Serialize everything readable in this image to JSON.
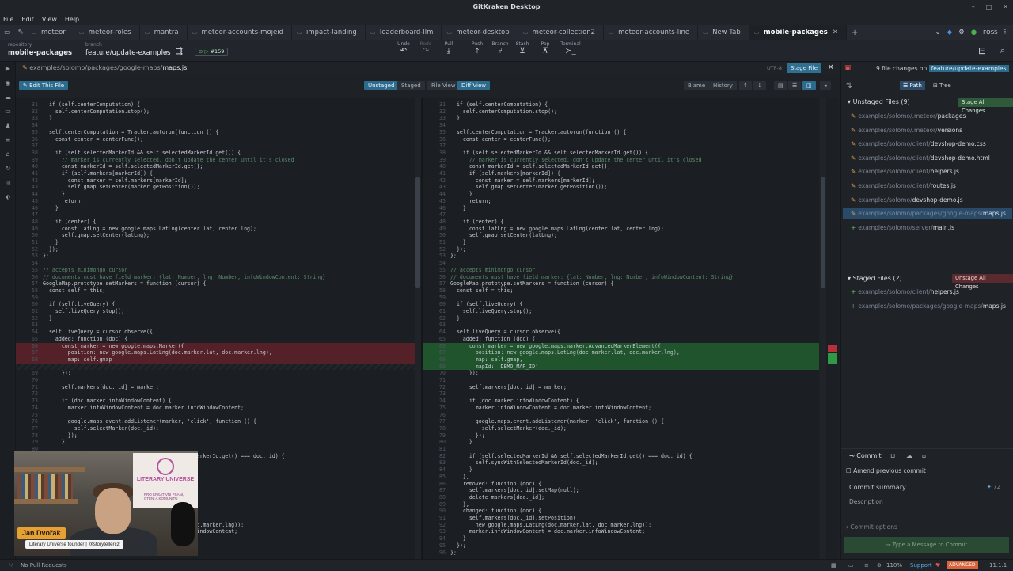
{
  "window": {
    "title": "GitKraken Desktop",
    "min": "–",
    "max": "□",
    "close": "✕"
  },
  "menu": [
    "File",
    "Edit",
    "View",
    "Help"
  ],
  "tabs": [
    {
      "label": "meteor",
      "active": false
    },
    {
      "label": "meteor-roles",
      "active": false
    },
    {
      "label": "mantra",
      "active": false
    },
    {
      "label": "meteor-accounts-mojeid",
      "active": false
    },
    {
      "label": "impact-landing",
      "active": false
    },
    {
      "label": "leaderboard-llm",
      "active": false
    },
    {
      "label": "meteor-desktop",
      "active": false
    },
    {
      "label": "meteor-collection2",
      "active": false
    },
    {
      "label": "meteor-accounts-line",
      "active": false
    },
    {
      "label": "New Tab",
      "active": false
    },
    {
      "label": "mobile-packages",
      "active": true
    }
  ],
  "toolbar": {
    "repo_label": "repository",
    "repo": "mobile-packages",
    "branch_label": "branch",
    "branch": "feature/update-examples",
    "pr_badge": "#159",
    "actions": [
      "Undo",
      "Redo",
      "Pull",
      "Push",
      "Branch",
      "Stash",
      "Pop",
      "Terminal"
    ],
    "org": "FOSS"
  },
  "file": {
    "dir": "examples/solomo/packages/google-maps/",
    "name": "maps.js",
    "encoding": "UTF-8",
    "stage_label": "Stage File"
  },
  "views": {
    "edit": "Edit This File",
    "unstaged": "Unstaged",
    "staged": "Staged",
    "file_view": "File View",
    "diff_view": "Diff View",
    "blame": "Blame",
    "history": "History"
  },
  "left_code": [
    [
      31,
      "  if (self.centerComputation) {",
      ""
    ],
    [
      32,
      "    self.centerComputation.stop();",
      ""
    ],
    [
      33,
      "  }",
      ""
    ],
    [
      34,
      "",
      ""
    ],
    [
      35,
      "  self.centerComputation = Tracker.autorun(function () {",
      ""
    ],
    [
      36,
      "    const center = centerFunc();",
      ""
    ],
    [
      37,
      "",
      ""
    ],
    [
      38,
      "    if (self.selectedMarkerId && self.selectedMarkerId.get()) {",
      ""
    ],
    [
      39,
      "      // marker is currently selected, don't update the center until it's closed",
      "cm"
    ],
    [
      40,
      "      const markerId = self.selectedMarkerId.get();",
      ""
    ],
    [
      41,
      "      if (self.markers[markerId]) {",
      ""
    ],
    [
      42,
      "        const marker = self.markers[markerId];",
      ""
    ],
    [
      43,
      "        self.gmap.setCenter(marker.getPosition());",
      ""
    ],
    [
      44,
      "      }",
      ""
    ],
    [
      45,
      "      return;",
      ""
    ],
    [
      46,
      "    }",
      ""
    ],
    [
      47,
      "",
      ""
    ],
    [
      48,
      "    if (center) {",
      ""
    ],
    [
      49,
      "      const latLng = new google.maps.LatLng(center.lat, center.lng);",
      ""
    ],
    [
      50,
      "      self.gmap.setCenter(latLng);",
      ""
    ],
    [
      51,
      "    }",
      ""
    ],
    [
      52,
      "  });",
      ""
    ],
    [
      53,
      "};",
      ""
    ],
    [
      54,
      "",
      ""
    ],
    [
      55,
      "// accepts minimongo cursor",
      "cm"
    ],
    [
      56,
      "// documents must have field marker: {lat: Number, lng: Number, infoWindowContent: String}",
      "cm"
    ],
    [
      57,
      "GoogleMap.prototype.setMarkers = function (cursor) {",
      ""
    ],
    [
      58,
      "  const self = this;",
      ""
    ],
    [
      59,
      "",
      ""
    ],
    [
      60,
      "  if (self.liveQuery) {",
      ""
    ],
    [
      61,
      "    self.liveQuery.stop();",
      ""
    ],
    [
      62,
      "  }",
      ""
    ],
    [
      63,
      "",
      ""
    ],
    [
      64,
      "  self.liveQuery = cursor.observe({",
      ""
    ],
    [
      65,
      "    added: function (doc) {",
      ""
    ],
    [
      66,
      "      const marker = new google.maps.Marker({",
      "del"
    ],
    [
      67,
      "        position: new google.maps.LatLng(doc.marker.lat, doc.marker.lng),",
      "del"
    ],
    [
      68,
      "        map: self.gmap",
      "del"
    ],
    [
      "",
      "",
      "hatch"
    ],
    [
      69,
      "      });",
      ""
    ],
    [
      70,
      "",
      ""
    ],
    [
      71,
      "      self.markers[doc._id] = marker;",
      ""
    ],
    [
      72,
      "",
      ""
    ],
    [
      73,
      "      if (doc.marker.infoWindowContent) {",
      ""
    ],
    [
      74,
      "        marker.infoWindowContent = doc.marker.infoWindowContent;",
      ""
    ],
    [
      75,
      "",
      ""
    ],
    [
      76,
      "        google.maps.event.addListener(marker, 'click', function () {",
      ""
    ],
    [
      77,
      "          self.selectMarker(doc._id);",
      ""
    ],
    [
      78,
      "        });",
      ""
    ],
    [
      79,
      "      }",
      ""
    ],
    [
      80,
      "",
      ""
    ],
    [
      81,
      "      if (self.selectedMarkerId && self.selectedMarkerId.get() === doc._id) {",
      ""
    ],
    [
      82,
      "        self.syncWithSelectedMarkerId(doc._id);",
      ""
    ],
    [
      83,
      "      }",
      ""
    ],
    [
      84,
      "    },",
      ""
    ],
    [
      85,
      "    removed: function (doc) {",
      ""
    ],
    [
      86,
      "      self.markers[doc._id].setMap(null);",
      ""
    ],
    [
      87,
      "      delete markers[doc._id];",
      ""
    ],
    [
      88,
      "    },",
      ""
    ],
    [
      89,
      "    changed: function (doc) {",
      ""
    ],
    [
      90,
      "      self.markers[doc._id].setPosition(",
      ""
    ],
    [
      91,
      "        new google.maps.LatLng(doc.marker.lat, doc.marker.lng));",
      ""
    ],
    [
      92,
      "      marker.infoWindowContent = doc.marker.infoWindowContent;",
      ""
    ]
  ],
  "right_code": [
    [
      31,
      "  if (self.centerComputation) {",
      ""
    ],
    [
      32,
      "    self.centerComputation.stop();",
      ""
    ],
    [
      33,
      "  }",
      ""
    ],
    [
      34,
      "",
      ""
    ],
    [
      35,
      "  self.centerComputation = Tracker.autorun(function () {",
      ""
    ],
    [
      36,
      "    const center = centerFunc();",
      ""
    ],
    [
      37,
      "",
      ""
    ],
    [
      38,
      "    if (self.selectedMarkerId && self.selectedMarkerId.get()) {",
      ""
    ],
    [
      39,
      "      // marker is currently selected, don't update the center until it's closed",
      "cm"
    ],
    [
      40,
      "      const markerId = self.selectedMarkerId.get();",
      ""
    ],
    [
      41,
      "      if (self.markers[markerId]) {",
      ""
    ],
    [
      42,
      "        const marker = self.markers[markerId];",
      ""
    ],
    [
      43,
      "        self.gmap.setCenter(marker.getPosition());",
      ""
    ],
    [
      44,
      "      }",
      ""
    ],
    [
      45,
      "      return;",
      ""
    ],
    [
      46,
      "    }",
      ""
    ],
    [
      47,
      "",
      ""
    ],
    [
      48,
      "    if (center) {",
      ""
    ],
    [
      49,
      "      const latLng = new google.maps.LatLng(center.lat, center.lng);",
      ""
    ],
    [
      50,
      "      self.gmap.setCenter(latLng);",
      ""
    ],
    [
      51,
      "    }",
      ""
    ],
    [
      52,
      "  });",
      ""
    ],
    [
      53,
      "};",
      ""
    ],
    [
      54,
      "",
      ""
    ],
    [
      55,
      "// accepts minimongo cursor",
      "cm"
    ],
    [
      56,
      "// documents must have field marker: {lat: Number, lng: Number, infoWindowContent: String}",
      "cm"
    ],
    [
      57,
      "GoogleMap.prototype.setMarkers = function (cursor) {",
      ""
    ],
    [
      58,
      "  const self = this;",
      ""
    ],
    [
      59,
      "",
      ""
    ],
    [
      60,
      "  if (self.liveQuery) {",
      ""
    ],
    [
      61,
      "    self.liveQuery.stop();",
      ""
    ],
    [
      62,
      "  }",
      ""
    ],
    [
      63,
      "",
      ""
    ],
    [
      64,
      "  self.liveQuery = cursor.observe({",
      ""
    ],
    [
      65,
      "    added: function (doc) {",
      ""
    ],
    [
      66,
      "      const marker = new google.maps.marker.AdvancedMarkerElement({",
      "add"
    ],
    [
      67,
      "        position: new google.maps.LatLng(doc.marker.lat, doc.marker.lng),",
      "add"
    ],
    [
      68,
      "        map: self.gmap,",
      "add"
    ],
    [
      69,
      "        mapId: 'DEMO_MAP_ID'",
      "add"
    ],
    [
      70,
      "      });",
      ""
    ],
    [
      71,
      "",
      ""
    ],
    [
      72,
      "      self.markers[doc._id] = marker;",
      ""
    ],
    [
      73,
      "",
      ""
    ],
    [
      74,
      "      if (doc.marker.infoWindowContent) {",
      ""
    ],
    [
      75,
      "        marker.infoWindowContent = doc.marker.infoWindowContent;",
      ""
    ],
    [
      76,
      "",
      ""
    ],
    [
      77,
      "        google.maps.event.addListener(marker, 'click', function () {",
      ""
    ],
    [
      78,
      "          self.selectMarker(doc._id);",
      ""
    ],
    [
      79,
      "        });",
      ""
    ],
    [
      80,
      "      }",
      ""
    ],
    [
      81,
      "",
      ""
    ],
    [
      82,
      "      if (self.selectedMarkerId && self.selectedMarkerId.get() === doc._id) {",
      ""
    ],
    [
      83,
      "        self.syncWithSelectedMarkerId(doc._id);",
      ""
    ],
    [
      84,
      "      }",
      ""
    ],
    [
      85,
      "    },",
      ""
    ],
    [
      86,
      "    removed: function (doc) {",
      ""
    ],
    [
      87,
      "      self.markers[doc._id].setMap(null);",
      ""
    ],
    [
      88,
      "      delete markers[doc._id];",
      ""
    ],
    [
      89,
      "    },",
      ""
    ],
    [
      90,
      "    changed: function (doc) {",
      ""
    ],
    [
      91,
      "      self.markers[doc._id].setPosition(",
      ""
    ],
    [
      92,
      "        new google.maps.LatLng(doc.marker.lat, doc.marker.lng));",
      ""
    ],
    [
      93,
      "      marker.infoWindowContent = doc.marker.infoWindowContent;",
      ""
    ],
    [
      94,
      "    }",
      ""
    ],
    [
      95,
      "  });",
      ""
    ],
    [
      96,
      "};",
      ""
    ]
  ],
  "panel": {
    "summary_prefix": "9 file changes on",
    "summary_branch": "feature/update-examples",
    "path_label": "Path",
    "tree_label": "Tree",
    "unstaged_title": "Unstaged Files (9)",
    "stage_all": "Stage All Changes",
    "unstaged": [
      {
        "dir": "examples/solomo/.meteor/",
        "name": "packages",
        "kind": "mod"
      },
      {
        "dir": "examples/solomo/.meteor/",
        "name": "versions",
        "kind": "mod"
      },
      {
        "dir": "examples/solomo/client/",
        "name": "devshop-demo.css",
        "kind": "mod"
      },
      {
        "dir": "examples/solomo/client/",
        "name": "devshop-demo.html",
        "kind": "mod"
      },
      {
        "dir": "examples/solomo/client/",
        "name": "helpers.js",
        "kind": "mod"
      },
      {
        "dir": "examples/solomo/client/",
        "name": "routes.js",
        "kind": "mod"
      },
      {
        "dir": "examples/solomo/",
        "name": "devshop-demo.js",
        "kind": "mod"
      },
      {
        "dir": "examples/solomo/packages/google-maps/",
        "name": "maps.js",
        "kind": "mod"
      },
      {
        "dir": "examples/solomo/server/",
        "name": "main.js",
        "kind": "add"
      }
    ],
    "staged_title": "Staged Files (2)",
    "unstage_all": "Unstage All Changes",
    "staged": [
      {
        "dir": "examples/solomo/client/",
        "name": "helpers.js",
        "kind": "add"
      },
      {
        "dir": "examples/solomo/packages/google-maps/",
        "name": "maps.js",
        "kind": "add"
      }
    ],
    "commit_tab": "Commit",
    "amend": "Amend previous commit",
    "summary_placeholder": "Commit summary",
    "summary_count": "72",
    "description_placeholder": "Description",
    "commit_options": "Commit options",
    "commit_button": "Type a Message to Commit"
  },
  "status": {
    "left": "No Pull Requests",
    "zoom": "110%",
    "support": "Support",
    "badge": "ADVANCED",
    "version": "11.1.1"
  },
  "webcam": {
    "name": "Jan Dvořák",
    "title": "Literary Universe founder | @storytellercz",
    "poster_title": "LITERARY UNIVERSE",
    "poster_sub": "PRO KREATIVNÍ PSANÍ, ČTENÍ A KOMUNITU"
  }
}
